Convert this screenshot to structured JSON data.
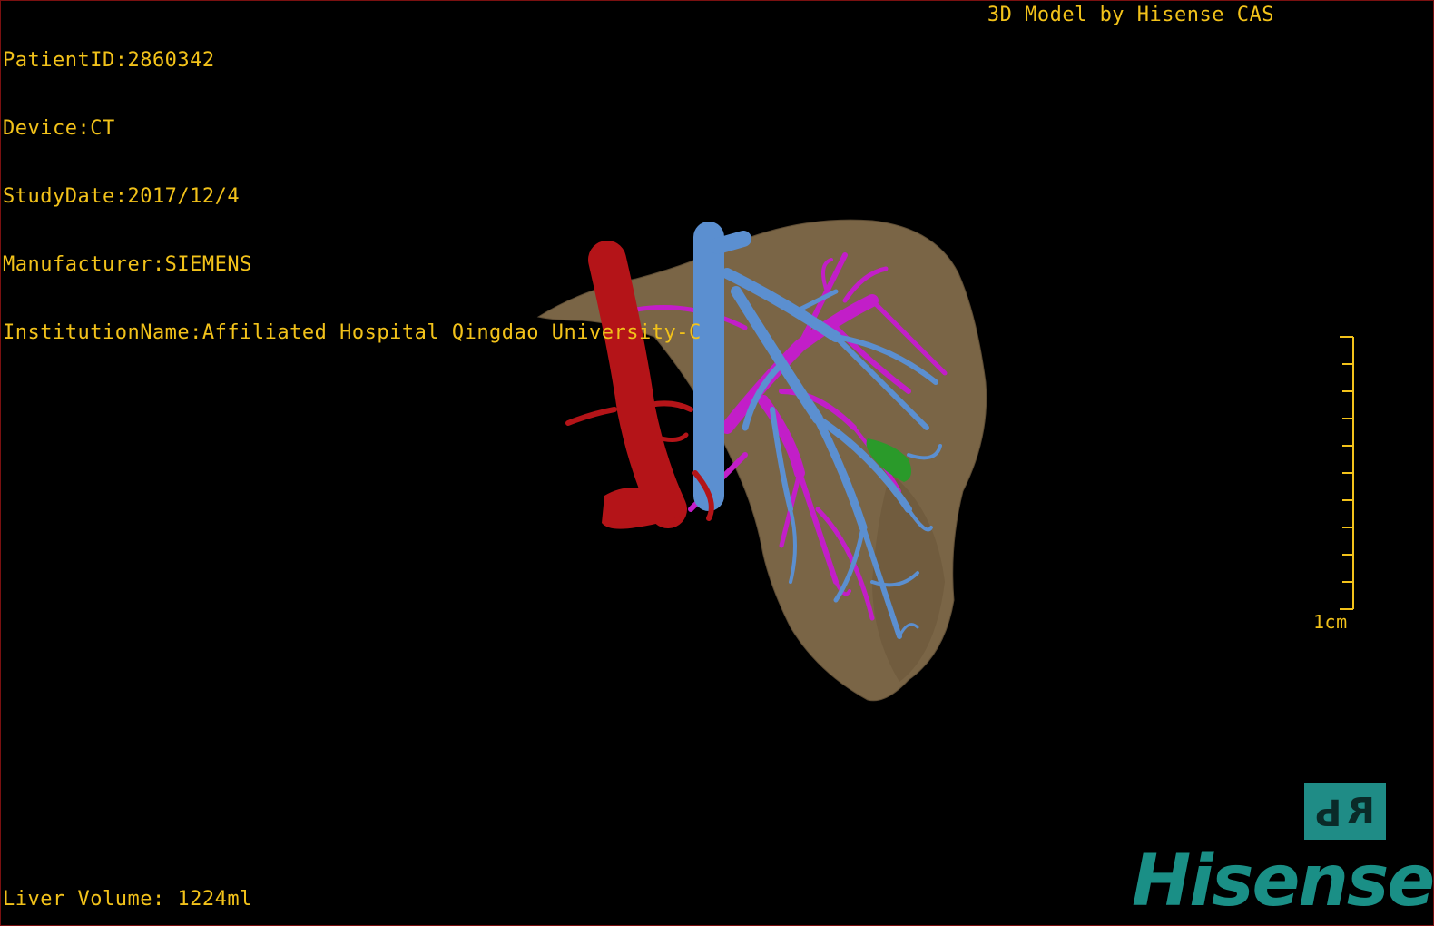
{
  "header": {
    "patient_id": "PatientID:2860342",
    "device": "Device:CT",
    "study_date": "StudyDate:2017/12/4",
    "manufacturer": "Manufacturer:SIEMENS",
    "institution": "InstitutionName:Affiliated Hospital Qingdao University-C",
    "brand_caption": "3D Model by Hisense CAS"
  },
  "footer": {
    "liver_volume": "Liver Volume: 1224ml",
    "logo": "Hisense"
  },
  "scale_bar": {
    "label": "1cm"
  },
  "orientation": {
    "left": "P",
    "right": "R"
  },
  "colors": {
    "text": "#f2c21a",
    "liver": "#7a6546",
    "hepatic_vein": "#5b8fd0",
    "portal_vein": "#c21ec8",
    "artery": "#b41418",
    "lesion": "#2a9a2a",
    "brand": "#1a8f86"
  }
}
